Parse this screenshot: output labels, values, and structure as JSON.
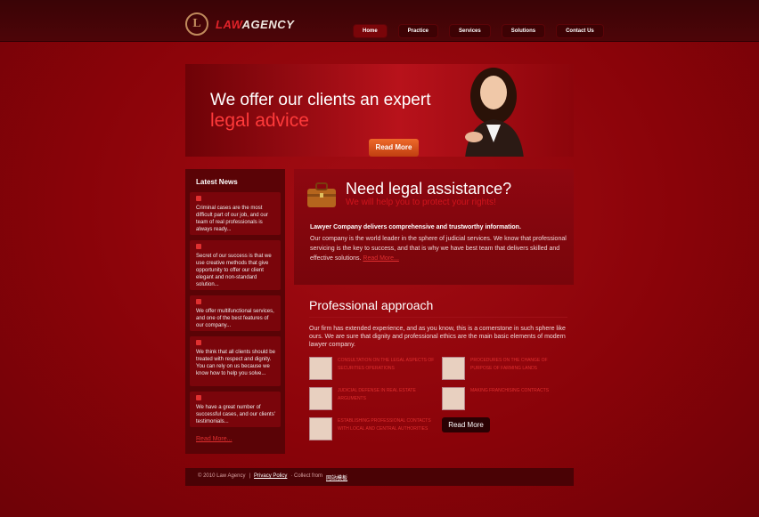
{
  "brand": {
    "name_part1": "LAW",
    "name_part2": "AGENCY",
    "emblem_letter": "L"
  },
  "nav": [
    {
      "label": "Home"
    },
    {
      "label": "Practice"
    },
    {
      "label": "Services"
    },
    {
      "label": "Solutions"
    },
    {
      "label": "Contact Us"
    }
  ],
  "hero": {
    "line1": "We offer our clients an expert",
    "line2": "legal advice",
    "button": "Read More"
  },
  "latest_news": {
    "title": "Latest News",
    "items": [
      {
        "text": "Criminal cases are the most difficult part of our job, and our team of real professionals is always ready..."
      },
      {
        "text": "Secret of our success is that we use creative methods that give opportunity to offer our client elegant and non-standard solution..."
      },
      {
        "text": "We offer multifunctional services, and one of the best features of our company..."
      },
      {
        "text": "We think that all clients should be treated with respect and dignity. You can rely on us because we know how to help you solve..."
      },
      {
        "text": "We have a great number of successful cases, and our clients' testimonials..."
      }
    ],
    "more": "Read More..."
  },
  "assistance": {
    "title": "Need legal assistance?",
    "subtitle": "We will help you to protect your rights!",
    "lead": "Lawyer Company delivers comprehensive and trustworthy information.",
    "body": "Our company is the world leader in the sphere of judicial services. We know that professional servicing is the key to success, and that is why we have best team that delivers skilled and effective solutions.",
    "more": "Read More..."
  },
  "professional": {
    "title": "Professional approach",
    "body": "Our firm has extended experience, and as you know, this is a cornerstone in such sphere like ours. We are sure that dignity and professional ethics are the main basic elements of modern lawyer company.",
    "services": [
      {
        "label": "Consultation on the legal aspects of securities operations"
      },
      {
        "label": "Procedures on the change of purpose of farming lands"
      },
      {
        "label": "Judicial defense in real estate arguments"
      },
      {
        "label": "Making franchising contracts"
      },
      {
        "label": "Establishing professional contacts with local and central authorities"
      }
    ],
    "button": "Read More"
  },
  "footer": {
    "copyright": "© 2010 Law Agency",
    "sep": "|",
    "privacy": "Privacy Policy",
    "collect": "· Collect from",
    "collect_link": "网站模板"
  },
  "colors": {
    "background": "#8a0309",
    "accent": "#e03030",
    "button": "#e0561e"
  }
}
